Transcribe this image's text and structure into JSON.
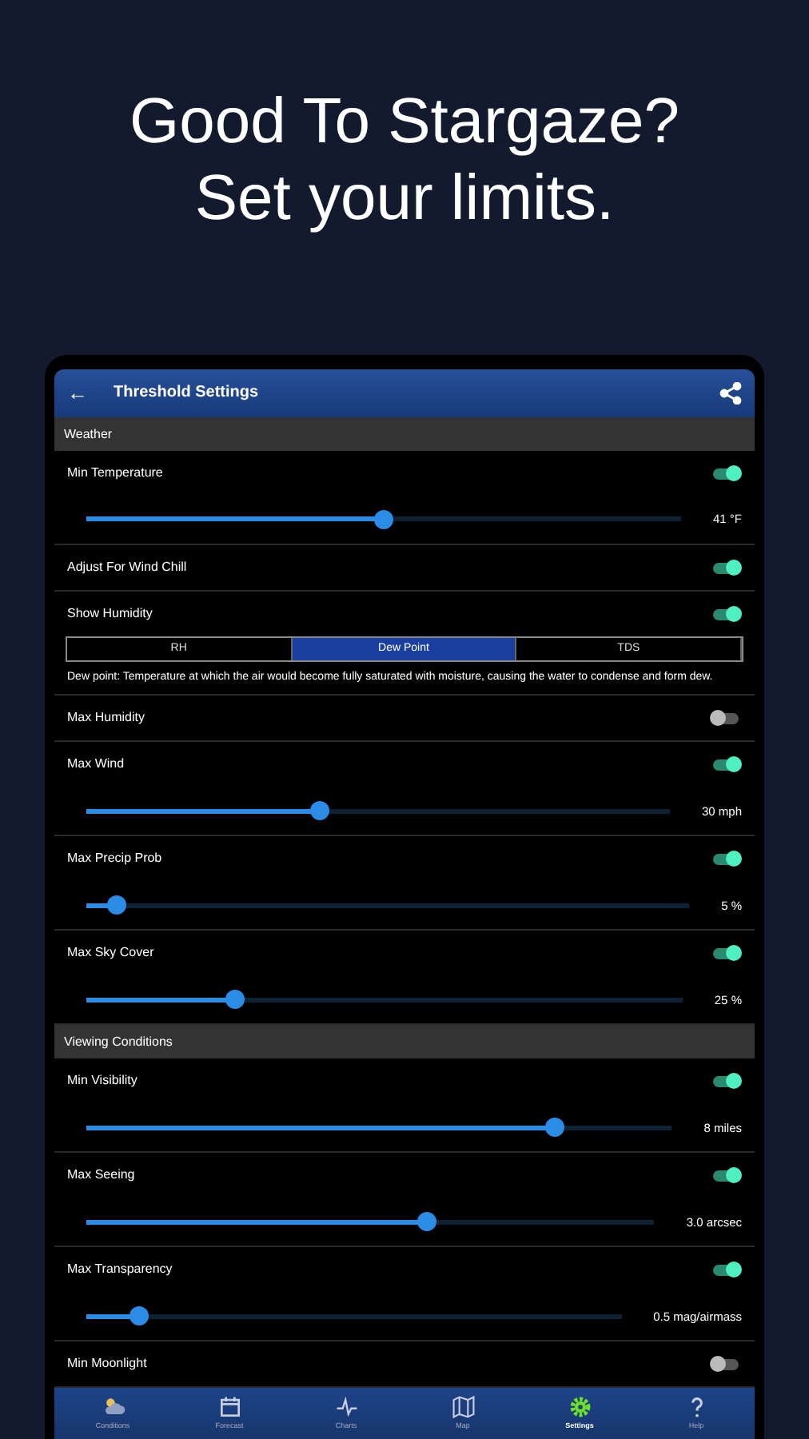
{
  "headline": [
    "Good To Stargaze?",
    "Set your limits."
  ],
  "app_bar": {
    "back": "←",
    "title": "Threshold Settings"
  },
  "sections": [
    {
      "title": "Weather",
      "items": [
        {
          "kind": "slider",
          "label": "Min Temperature",
          "on": true,
          "level": 0.5,
          "reading": "41 °F"
        },
        {
          "kind": "toggle",
          "label": "Adjust For Wind Chill",
          "on": true
        },
        {
          "kind": "segmented",
          "label": "Show Humidity",
          "on": true,
          "segments": [
            {
              "label": "RH",
              "selected": false
            },
            {
              "label": "Dew Point",
              "selected": true
            },
            {
              "label": "TDS",
              "selected": false
            }
          ],
          "note": "Dew point: Temperature at which the air would become fully saturated with moisture, causing the water to condense and form dew."
        },
        {
          "kind": "toggle",
          "label": "Max Humidity",
          "on": false
        },
        {
          "kind": "slider",
          "label": "Max Wind",
          "on": true,
          "level": 0.4,
          "reading": "30 mph"
        },
        {
          "kind": "slider",
          "label": "Max Precip Prob",
          "on": true,
          "level": 0.05,
          "reading": "5 %"
        },
        {
          "kind": "slider",
          "label": "Max Sky Cover",
          "on": true,
          "level": 0.25,
          "reading": "25 %"
        }
      ]
    },
    {
      "title": "Viewing Conditions",
      "items": [
        {
          "kind": "slider",
          "label": "Min Visibility",
          "on": true,
          "level": 0.8,
          "reading": "8 miles"
        },
        {
          "kind": "slider",
          "label": "Max Seeing",
          "on": true,
          "level": 0.6,
          "reading": "3.0 arcsec"
        },
        {
          "kind": "slider",
          "label": "Max Transparency",
          "on": true,
          "level": 0.1,
          "reading": "0.5 mag/airmass"
        },
        {
          "kind": "toggle",
          "label": "Min Moonlight",
          "on": false
        }
      ]
    }
  ],
  "nav": [
    {
      "label": "Conditions",
      "selected": false
    },
    {
      "label": "Forecast",
      "selected": false
    },
    {
      "label": "Charts",
      "selected": false
    },
    {
      "label": "Map",
      "selected": false
    },
    {
      "label": "Settings",
      "selected": true
    },
    {
      "label": "Help",
      "selected": false
    }
  ]
}
